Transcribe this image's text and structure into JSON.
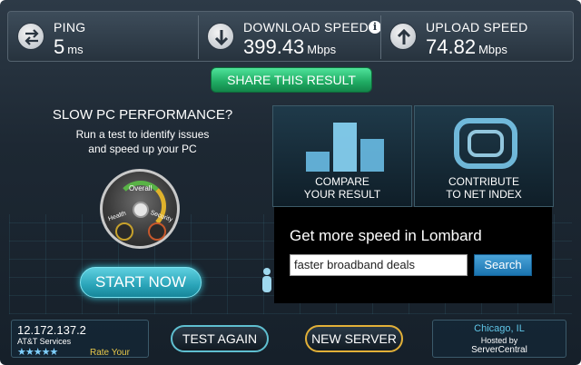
{
  "ping": {
    "label": "PING",
    "value": "5",
    "unit": "ms"
  },
  "download": {
    "label": "DOWNLOAD SPEED",
    "value": "399.43",
    "unit": "Mbps",
    "info_icon": "info-icon"
  },
  "upload": {
    "label": "UPLOAD SPEED",
    "value": "74.82",
    "unit": "Mbps"
  },
  "share_button": "SHARE THIS RESULT",
  "slow_pc": {
    "title": "SLOW PC PERFORMANCE?",
    "subtitle_line1": "Run a test to identify issues",
    "subtitle_line2": "and speed up your PC",
    "gauge_overall": "Overall",
    "gauge_health": "Health",
    "gauge_security": "Security",
    "start_button": "START NOW"
  },
  "tiles": {
    "compare_line1": "COMPARE",
    "compare_line2": "YOUR RESULT",
    "net_line1": "CONTRIBUTE",
    "net_line2": "TO NET INDEX"
  },
  "ad": {
    "title": "Get more speed in Lombard",
    "input_value": "faster broadband deals",
    "search_button": "Search"
  },
  "bottom": {
    "ip": "12.172.137.2",
    "isp": "AT&T Services",
    "stars": "★★★★★",
    "rate_label": "Rate Your",
    "test_again": "TEST AGAIN",
    "new_server": "NEW SERVER",
    "server_city": "Chicago, IL",
    "hosted_by": "Hosted by",
    "host_name": "ServerCentral"
  },
  "colors": {
    "share_green": "#1faa62",
    "start_cyan": "#2aa4b8",
    "new_server_border": "#e2b038",
    "test_again_border": "#5fbfd0"
  }
}
